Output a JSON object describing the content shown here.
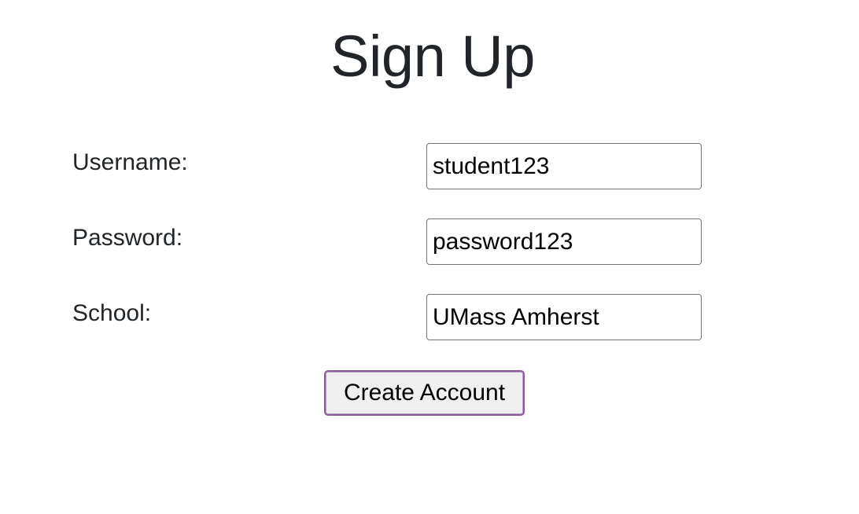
{
  "page": {
    "title": "Sign Up"
  },
  "form": {
    "username": {
      "label": "Username:",
      "value": "student123"
    },
    "password": {
      "label": "Password:",
      "value": "password123"
    },
    "school": {
      "label": "School:",
      "value": "UMass Amherst"
    },
    "submit_label": "Create Account"
  },
  "colors": {
    "text": "#212529",
    "input_border": "#767676",
    "button_background": "#efefef",
    "button_focus_border": "#8b5a9a"
  }
}
